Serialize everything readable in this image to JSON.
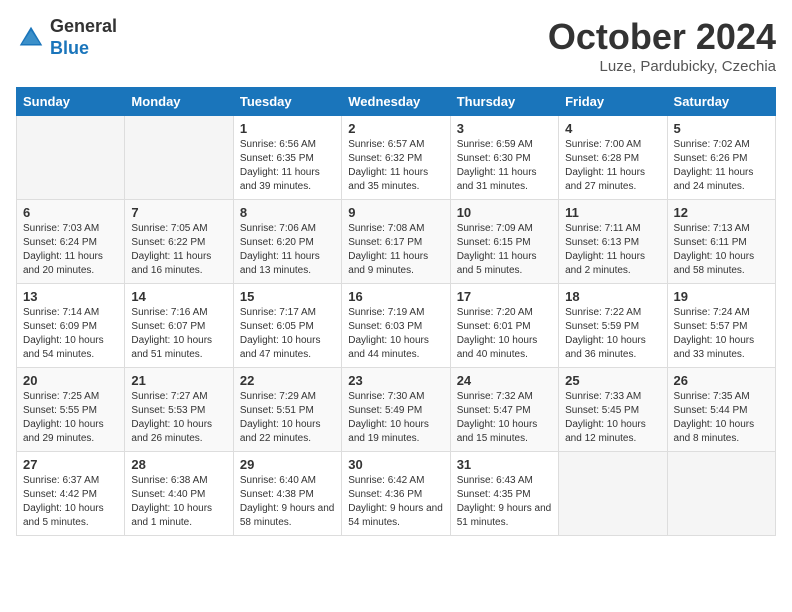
{
  "header": {
    "logo_line1": "General",
    "logo_line2": "Blue",
    "month": "October 2024",
    "location": "Luze, Pardubicky, Czechia"
  },
  "days_of_week": [
    "Sunday",
    "Monday",
    "Tuesday",
    "Wednesday",
    "Thursday",
    "Friday",
    "Saturday"
  ],
  "weeks": [
    [
      {
        "num": "",
        "info": ""
      },
      {
        "num": "",
        "info": ""
      },
      {
        "num": "1",
        "info": "Sunrise: 6:56 AM\nSunset: 6:35 PM\nDaylight: 11 hours\nand 39 minutes."
      },
      {
        "num": "2",
        "info": "Sunrise: 6:57 AM\nSunset: 6:32 PM\nDaylight: 11 hours\nand 35 minutes."
      },
      {
        "num": "3",
        "info": "Sunrise: 6:59 AM\nSunset: 6:30 PM\nDaylight: 11 hours\nand 31 minutes."
      },
      {
        "num": "4",
        "info": "Sunrise: 7:00 AM\nSunset: 6:28 PM\nDaylight: 11 hours\nand 27 minutes."
      },
      {
        "num": "5",
        "info": "Sunrise: 7:02 AM\nSunset: 6:26 PM\nDaylight: 11 hours\nand 24 minutes."
      }
    ],
    [
      {
        "num": "6",
        "info": "Sunrise: 7:03 AM\nSunset: 6:24 PM\nDaylight: 11 hours\nand 20 minutes."
      },
      {
        "num": "7",
        "info": "Sunrise: 7:05 AM\nSunset: 6:22 PM\nDaylight: 11 hours\nand 16 minutes."
      },
      {
        "num": "8",
        "info": "Sunrise: 7:06 AM\nSunset: 6:20 PM\nDaylight: 11 hours\nand 13 minutes."
      },
      {
        "num": "9",
        "info": "Sunrise: 7:08 AM\nSunset: 6:17 PM\nDaylight: 11 hours\nand 9 minutes."
      },
      {
        "num": "10",
        "info": "Sunrise: 7:09 AM\nSunset: 6:15 PM\nDaylight: 11 hours\nand 5 minutes."
      },
      {
        "num": "11",
        "info": "Sunrise: 7:11 AM\nSunset: 6:13 PM\nDaylight: 11 hours\nand 2 minutes."
      },
      {
        "num": "12",
        "info": "Sunrise: 7:13 AM\nSunset: 6:11 PM\nDaylight: 10 hours\nand 58 minutes."
      }
    ],
    [
      {
        "num": "13",
        "info": "Sunrise: 7:14 AM\nSunset: 6:09 PM\nDaylight: 10 hours\nand 54 minutes."
      },
      {
        "num": "14",
        "info": "Sunrise: 7:16 AM\nSunset: 6:07 PM\nDaylight: 10 hours\nand 51 minutes."
      },
      {
        "num": "15",
        "info": "Sunrise: 7:17 AM\nSunset: 6:05 PM\nDaylight: 10 hours\nand 47 minutes."
      },
      {
        "num": "16",
        "info": "Sunrise: 7:19 AM\nSunset: 6:03 PM\nDaylight: 10 hours\nand 44 minutes."
      },
      {
        "num": "17",
        "info": "Sunrise: 7:20 AM\nSunset: 6:01 PM\nDaylight: 10 hours\nand 40 minutes."
      },
      {
        "num": "18",
        "info": "Sunrise: 7:22 AM\nSunset: 5:59 PM\nDaylight: 10 hours\nand 36 minutes."
      },
      {
        "num": "19",
        "info": "Sunrise: 7:24 AM\nSunset: 5:57 PM\nDaylight: 10 hours\nand 33 minutes."
      }
    ],
    [
      {
        "num": "20",
        "info": "Sunrise: 7:25 AM\nSunset: 5:55 PM\nDaylight: 10 hours\nand 29 minutes."
      },
      {
        "num": "21",
        "info": "Sunrise: 7:27 AM\nSunset: 5:53 PM\nDaylight: 10 hours\nand 26 minutes."
      },
      {
        "num": "22",
        "info": "Sunrise: 7:29 AM\nSunset: 5:51 PM\nDaylight: 10 hours\nand 22 minutes."
      },
      {
        "num": "23",
        "info": "Sunrise: 7:30 AM\nSunset: 5:49 PM\nDaylight: 10 hours\nand 19 minutes."
      },
      {
        "num": "24",
        "info": "Sunrise: 7:32 AM\nSunset: 5:47 PM\nDaylight: 10 hours\nand 15 minutes."
      },
      {
        "num": "25",
        "info": "Sunrise: 7:33 AM\nSunset: 5:45 PM\nDaylight: 10 hours\nand 12 minutes."
      },
      {
        "num": "26",
        "info": "Sunrise: 7:35 AM\nSunset: 5:44 PM\nDaylight: 10 hours\nand 8 minutes."
      }
    ],
    [
      {
        "num": "27",
        "info": "Sunrise: 6:37 AM\nSunset: 4:42 PM\nDaylight: 10 hours\nand 5 minutes."
      },
      {
        "num": "28",
        "info": "Sunrise: 6:38 AM\nSunset: 4:40 PM\nDaylight: 10 hours\nand 1 minute."
      },
      {
        "num": "29",
        "info": "Sunrise: 6:40 AM\nSunset: 4:38 PM\nDaylight: 9 hours\nand 58 minutes."
      },
      {
        "num": "30",
        "info": "Sunrise: 6:42 AM\nSunset: 4:36 PM\nDaylight: 9 hours\nand 54 minutes."
      },
      {
        "num": "31",
        "info": "Sunrise: 6:43 AM\nSunset: 4:35 PM\nDaylight: 9 hours\nand 51 minutes."
      },
      {
        "num": "",
        "info": ""
      },
      {
        "num": "",
        "info": ""
      }
    ]
  ]
}
